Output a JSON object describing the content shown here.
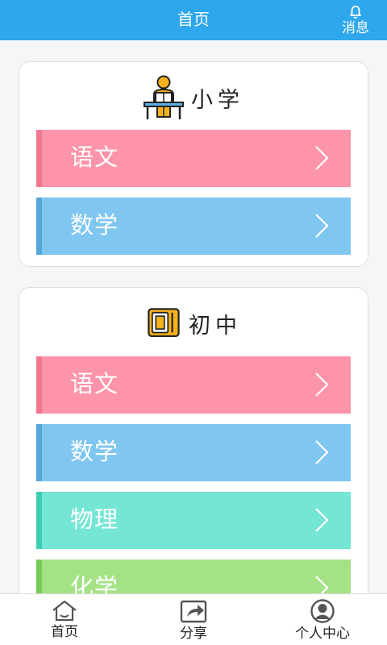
{
  "header": {
    "title": "首页",
    "message_label": "消息"
  },
  "sections": [
    {
      "title": "小学",
      "icon": "student-reading-icon",
      "items": [
        {
          "label": "语文",
          "color": "#fd94a9"
        },
        {
          "label": "数学",
          "color": "#7fc6f0"
        }
      ]
    },
    {
      "title": "初中",
      "icon": "book-icon",
      "items": [
        {
          "label": "语文",
          "color": "#fd94a9"
        },
        {
          "label": "数学",
          "color": "#7fc6f0"
        },
        {
          "label": "物理",
          "color": "#74e6d3"
        },
        {
          "label": "化学",
          "color": "#a5e287"
        }
      ]
    }
  ],
  "tabbar": {
    "home": "首页",
    "share": "分享",
    "profile": "个人中心"
  },
  "colors": {
    "appbar": "#2ea7ec"
  }
}
